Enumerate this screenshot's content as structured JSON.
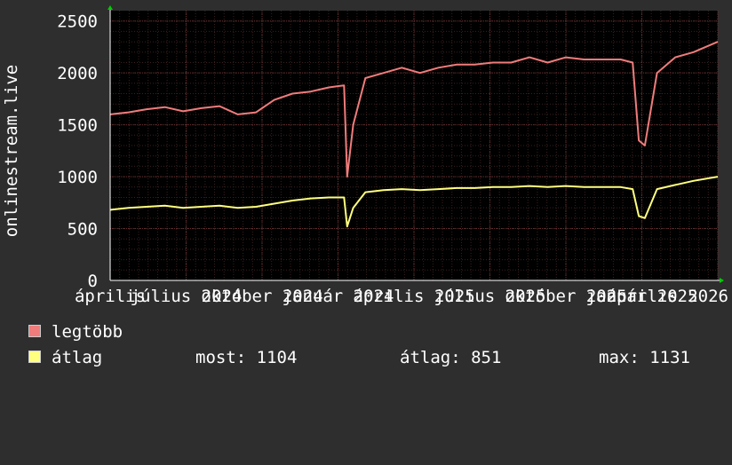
{
  "chart_data": {
    "type": "line",
    "ylabel": "onlinestream.live",
    "ylim": [
      0,
      2600
    ],
    "yticks": [
      0,
      500,
      1000,
      1500,
      2000,
      2500
    ],
    "grid": true,
    "xtick_labels": [
      "április",
      "július 2024",
      "október 2024",
      "január 2024",
      "április 2025",
      "július 2025",
      "október 2025",
      "január 2025",
      "április 2026"
    ],
    "xtick_positions": [
      0.0,
      0.125,
      0.25,
      0.375,
      0.5,
      0.625,
      0.75,
      0.875,
      1.0
    ],
    "series": [
      {
        "name": "legtöbb",
        "color": "#f07c7c",
        "x": [
          0.0,
          0.03,
          0.06,
          0.09,
          0.12,
          0.15,
          0.18,
          0.21,
          0.24,
          0.27,
          0.3,
          0.33,
          0.36,
          0.385,
          0.39,
          0.4,
          0.42,
          0.45,
          0.48,
          0.51,
          0.54,
          0.57,
          0.6,
          0.63,
          0.66,
          0.69,
          0.72,
          0.75,
          0.78,
          0.81,
          0.84,
          0.86,
          0.87,
          0.88,
          0.9,
          0.93,
          0.96,
          1.0
        ],
        "values": [
          1600,
          1620,
          1650,
          1670,
          1630,
          1660,
          1680,
          1600,
          1620,
          1740,
          1800,
          1820,
          1860,
          1880,
          1000,
          1500,
          1950,
          2000,
          2050,
          2000,
          2050,
          2080,
          2080,
          2100,
          2100,
          2150,
          2100,
          2150,
          2130,
          2130,
          2130,
          2100,
          1350,
          1300,
          2000,
          2150,
          2200,
          2300
        ]
      },
      {
        "name": "átlag",
        "color": "#ffff80",
        "x": [
          0.0,
          0.03,
          0.06,
          0.09,
          0.12,
          0.15,
          0.18,
          0.21,
          0.24,
          0.27,
          0.3,
          0.33,
          0.36,
          0.385,
          0.39,
          0.4,
          0.42,
          0.45,
          0.48,
          0.51,
          0.54,
          0.57,
          0.6,
          0.63,
          0.66,
          0.69,
          0.72,
          0.75,
          0.78,
          0.81,
          0.84,
          0.86,
          0.87,
          0.88,
          0.9,
          0.93,
          0.96,
          1.0
        ],
        "values": [
          680,
          700,
          710,
          720,
          700,
          710,
          720,
          700,
          710,
          740,
          770,
          790,
          800,
          800,
          520,
          700,
          850,
          870,
          880,
          870,
          880,
          890,
          890,
          900,
          900,
          910,
          900,
          910,
          900,
          900,
          900,
          880,
          620,
          600,
          880,
          920,
          960,
          1000
        ]
      }
    ]
  },
  "legend": {
    "max_label": "legtöbb",
    "avg_label": "átlag",
    "now_text": "most: 1104",
    "avg_text": "átlag: 851",
    "max_text": "max: 1131"
  }
}
